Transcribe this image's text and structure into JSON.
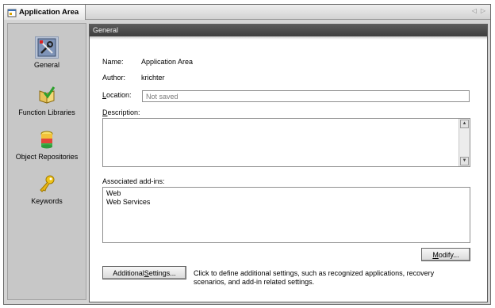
{
  "tab": {
    "title": "Application Area",
    "icon": "application-area-icon"
  },
  "sidebar": {
    "items": [
      {
        "label": "General",
        "icon": "general-tools-icon",
        "selected": true
      },
      {
        "label": "Function Libraries",
        "icon": "function-libraries-icon",
        "selected": false
      },
      {
        "label": "Object Repositories",
        "icon": "object-repositories-icon",
        "selected": false
      },
      {
        "label": "Keywords",
        "icon": "keywords-icon",
        "selected": false
      }
    ]
  },
  "main": {
    "header": "General",
    "name_label": "Name:",
    "name_value": "Application Area",
    "author_label": "Author:",
    "author_value": "krichter",
    "location_label_pre": "",
    "location_label_u": "L",
    "location_label_post": "ocation:",
    "location_value": "Not saved",
    "description_label_u": "D",
    "description_label_post": "escription:",
    "description_value": "",
    "addins_label": "Associated add-ins:",
    "addins": [
      "Web",
      "Web Services"
    ],
    "modify_u": "M",
    "modify_post": "odify...",
    "additional_pre": "Additional ",
    "additional_u": "S",
    "additional_post": "ettings...",
    "additional_desc": "Click to define additional settings, such as recognized applications, recovery scenarios, and add-in related settings."
  },
  "colors": {
    "header_bg": "#4a4a4a",
    "sidebar_bg": "#c7c7c7",
    "selected_bg": "#b8c3d6"
  }
}
